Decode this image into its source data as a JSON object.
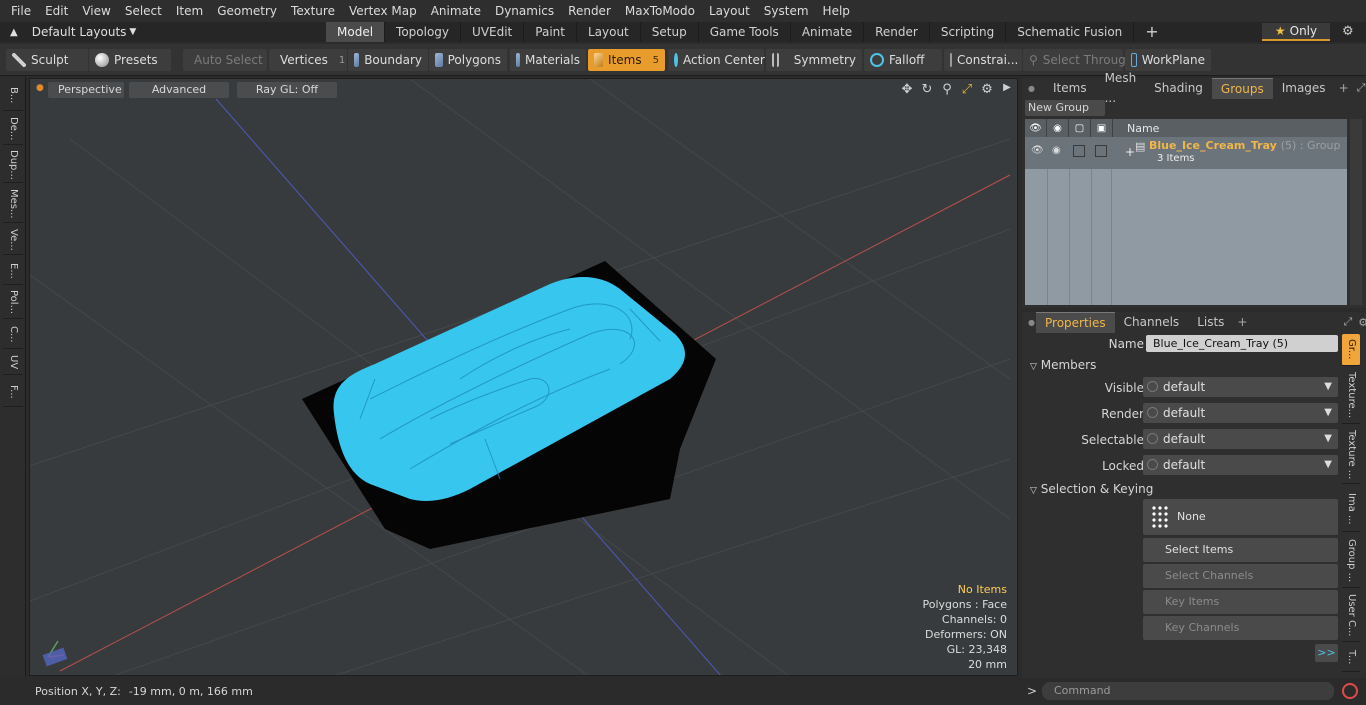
{
  "menu": [
    "File",
    "Edit",
    "View",
    "Select",
    "Item",
    "Geometry",
    "Texture",
    "Vertex Map",
    "Animate",
    "Dynamics",
    "Render",
    "MaxToModo",
    "Layout",
    "System",
    "Help"
  ],
  "layouts": {
    "label": "Default Layouts"
  },
  "tabs": [
    "Model",
    "Topology",
    "UVEdit",
    "Paint",
    "Layout",
    "Setup",
    "Game Tools",
    "Animate",
    "Render",
    "Scripting",
    "Schematic Fusion"
  ],
  "active_tab": "Model",
  "only_label": "Only",
  "toolbar": {
    "sculpt": "Sculpt",
    "presets": "Presets",
    "auto_select": "Auto Select",
    "vertices": "Vertices",
    "vertices_count": "1",
    "boundary": "Boundary",
    "polygons": "Polygons",
    "materials": "Materials",
    "items": "Items",
    "items_count": "5",
    "action_center": "Action Center",
    "symmetry": "Symmetry",
    "falloff": "Falloff",
    "constraints": "Constrai...",
    "select_through": "Select Through",
    "workplane": "WorkPlane"
  },
  "left_tabs": [
    "B...",
    "De...",
    "Dup...",
    "Mes...",
    "Ve...",
    "E...",
    "Pol...",
    "C...",
    "UV",
    "F..."
  ],
  "viewport": {
    "perspective": "Perspective",
    "advanced": "Advanced",
    "raygl": "Ray GL: Off",
    "overlay": {
      "no_items": "No Items",
      "polygons": "Polygons : Face",
      "channels": "Channels: 0",
      "deformers": "Deformers: ON",
      "gl": "GL: 23,348",
      "scale": "20 mm"
    },
    "colors": {
      "background": "#383b3d",
      "tray_fill": "#36c6ee",
      "tray_body": "#050505"
    }
  },
  "status": {
    "label": "Position X, Y, Z:",
    "value": "-19 mm, 0 m, 166 mm"
  },
  "groups_panel": {
    "tabs": [
      "Items",
      "Mesh ...",
      "Shading",
      "Groups",
      "Images"
    ],
    "active_tab": "Groups",
    "new_group": "New Group",
    "column_name": "Name",
    "group_name": "Blue_Ice_Cream_Tray",
    "group_suffix": "(5) : Group",
    "group_count": "3 Items"
  },
  "properties_panel": {
    "tabs": [
      "Properties",
      "Channels",
      "Lists"
    ],
    "active_tab": "Properties",
    "name_label": "Name",
    "name_value": "Blue_Ice_Cream_Tray (5)",
    "members_section": "Members",
    "visible_label": "Visible",
    "visible_value": "default",
    "render_label": "Render",
    "render_value": "default",
    "selectable_label": "Selectable",
    "selectable_value": "default",
    "locked_label": "Locked",
    "locked_value": "default",
    "selection_section": "Selection & Keying",
    "none_button": "None",
    "select_items": "Select Items",
    "select_channels": "Select Channels",
    "key_items": "Key Items",
    "key_channels": "Key Channels",
    "more": ">>"
  },
  "right_vtabs": [
    "Gr...",
    "Texture...",
    "Texture ...",
    "Ima ...",
    "Group ...",
    "User C...",
    "T..."
  ],
  "command": {
    "prompt": ">",
    "placeholder": "Command"
  }
}
